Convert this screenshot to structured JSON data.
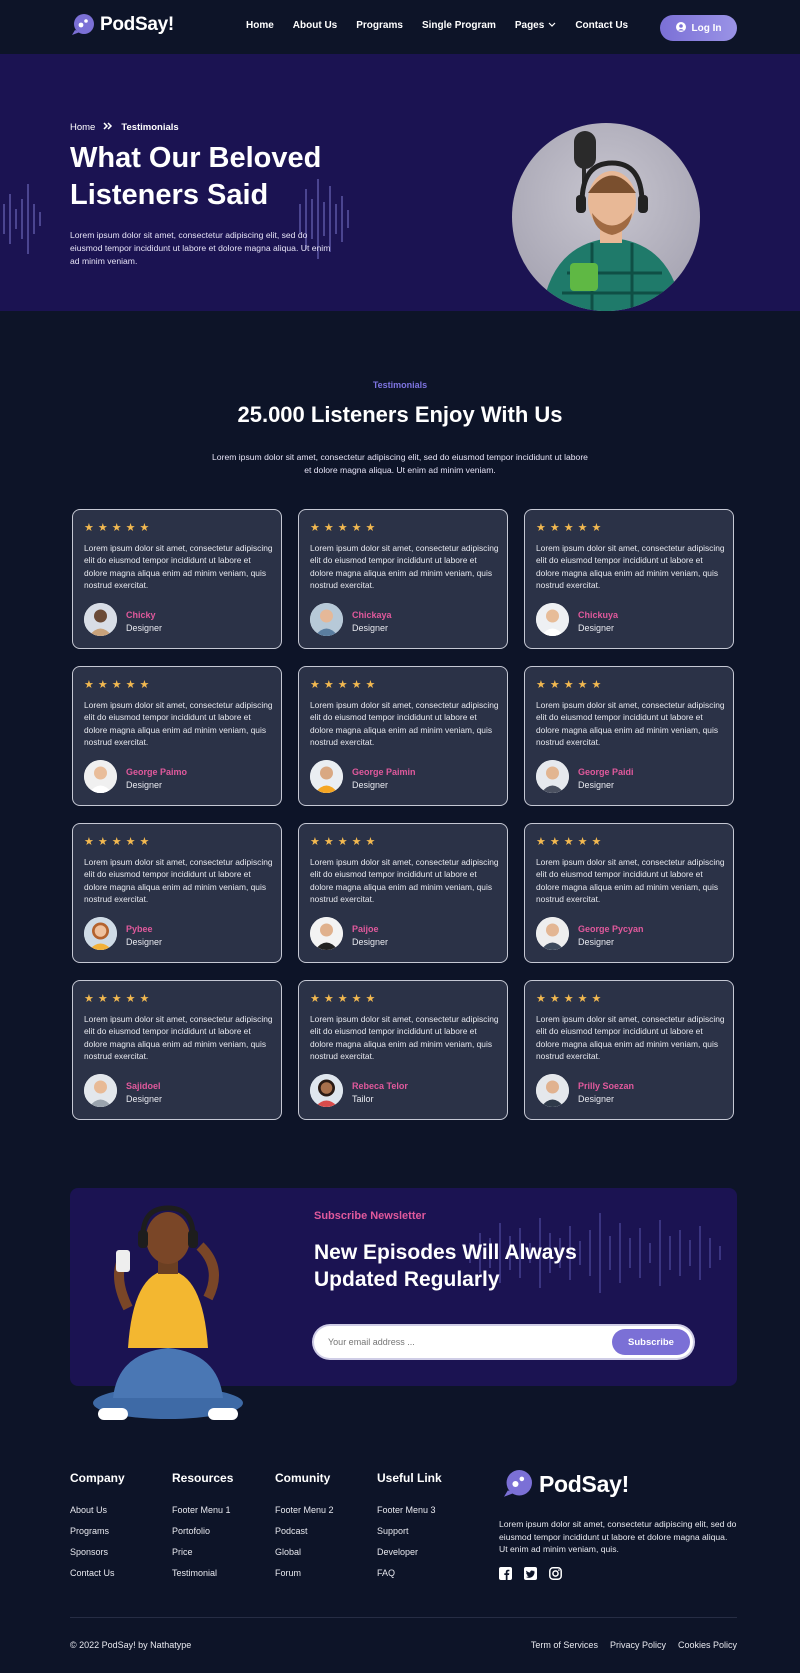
{
  "brand": {
    "name": "PodSay!",
    "accent": "#7b70d6",
    "pink": "#e0599c",
    "star": "#f3b950"
  },
  "nav": {
    "items": [
      {
        "label": "Home"
      },
      {
        "label": "About Us"
      },
      {
        "label": "Programs"
      },
      {
        "label": "Single Program"
      },
      {
        "label": "Pages"
      },
      {
        "label": "Contact Us"
      }
    ],
    "login_label": "Log In"
  },
  "hero": {
    "breadcrumb_home": "Home",
    "breadcrumb_current": "Testimonials",
    "title": "What Our Beloved Listeners Said",
    "description": "Lorem ipsum dolor sit amet, consectetur adipiscing elit, sed do eiusmod tempor incididunt ut labore et dolore magna aliqua. Ut enim ad minim veniam."
  },
  "testimonials": {
    "tag": "Testimonials",
    "title": "25.000 Listeners Enjoy With Us",
    "description": "Lorem ipsum dolor sit amet, consectetur adipiscing elit, sed do eiusmod tempor incididunt ut labore et dolore magna aliqua. Ut enim ad minim veniam.",
    "stars": "★★★★★",
    "rating": 5,
    "cards": [
      {
        "text": "Lorem ipsum dolor sit amet, consectetur adipiscing elit do eiusmod tempor incididunt ut labore et dolore magna aliqua enim ad minim veniam, quis nostrud exercitat.",
        "name": "Chicky",
        "role": "Designer"
      },
      {
        "text": "Lorem ipsum dolor sit amet, consectetur adipiscing elit do eiusmod tempor incididunt ut labore et dolore magna aliqua enim ad minim veniam, quis nostrud exercitat.",
        "name": "Chickaya",
        "role": "Designer"
      },
      {
        "text": "Lorem ipsum dolor sit amet, consectetur adipiscing elit do eiusmod tempor incididunt ut labore et dolore magna aliqua enim ad minim veniam, quis nostrud exercitat.",
        "name": "Chickuya",
        "role": "Designer"
      },
      {
        "text": "Lorem ipsum dolor sit amet, consectetur adipiscing elit do eiusmod tempor incididunt ut labore et dolore magna aliqua enim ad minim veniam, quis nostrud exercitat.",
        "name": "George Paimo",
        "role": "Designer"
      },
      {
        "text": "Lorem ipsum dolor sit amet, consectetur adipiscing elit do eiusmod tempor incididunt ut labore et dolore magna aliqua enim ad minim veniam, quis nostrud exercitat.",
        "name": "George Paimin",
        "role": "Designer"
      },
      {
        "text": "Lorem ipsum dolor sit amet, consectetur adipiscing elit do eiusmod tempor incididunt ut labore et dolore magna aliqua enim ad minim veniam, quis nostrud exercitat.",
        "name": "George Paidi",
        "role": "Designer"
      },
      {
        "text": "Lorem ipsum dolor sit amet, consectetur adipiscing elit do eiusmod tempor incididunt ut labore et dolore magna aliqua enim ad minim veniam, quis nostrud exercitat.",
        "name": "Pybee",
        "role": "Designer"
      },
      {
        "text": "Lorem ipsum dolor sit amet, consectetur adipiscing elit do eiusmod tempor incididunt ut labore et dolore magna aliqua enim ad minim veniam, quis nostrud exercitat.",
        "name": "Paijoe",
        "role": "Designer"
      },
      {
        "text": "Lorem ipsum dolor sit amet, consectetur adipiscing elit do eiusmod tempor incididunt ut labore et dolore magna aliqua enim ad minim veniam, quis nostrud exercitat.",
        "name": "George Pycyan",
        "role": "Designer"
      },
      {
        "text": "Lorem ipsum dolor sit amet, consectetur adipiscing elit do eiusmod tempor incididunt ut labore et dolore magna aliqua enim ad minim veniam, quis nostrud exercitat.",
        "name": "Sajidoel",
        "role": "Designer"
      },
      {
        "text": "Lorem ipsum dolor sit amet, consectetur adipiscing elit do eiusmod tempor incididunt ut labore et dolore magna aliqua enim ad minim veniam, quis nostrud exercitat.",
        "name": "Rebeca Telor",
        "role": "Tailor"
      },
      {
        "text": "Lorem ipsum dolor sit amet, consectetur adipiscing elit do eiusmod tempor incididunt ut labore et dolore magna aliqua enim ad minim veniam, quis nostrud exercitat.",
        "name": "Prilly Soezan",
        "role": "Designer"
      }
    ]
  },
  "newsletter": {
    "tag": "Subscribe Newsletter",
    "title": "New Episodes Will Always Updated Regularly",
    "placeholder": "Your email address ...",
    "button_label": "Subscribe"
  },
  "footer": {
    "columns": [
      {
        "heading": "Company",
        "links": [
          "About Us",
          "Programs",
          "Sponsors",
          "Contact Us"
        ]
      },
      {
        "heading": "Resources",
        "links": [
          "Footer Menu 1",
          "Portofolio",
          "Price",
          "Testimonial"
        ]
      },
      {
        "heading": "Comunity",
        "links": [
          "Footer Menu 2",
          "Podcast",
          "Global",
          "Forum"
        ]
      },
      {
        "heading": "Useful Link",
        "links": [
          "Footer Menu 3",
          "Support",
          "Developer",
          "FAQ"
        ]
      }
    ],
    "description": "Lorem ipsum dolor sit amet, consectetur adipiscing elit, sed do eiusmod tempor incididunt ut labore et dolore magna aliqua. Ut enim ad minim veniam, quis.",
    "socials": [
      "facebook-icon",
      "twitter-icon",
      "instagram-icon"
    ],
    "copyright": "© 2022 PodSay! by Nathatype",
    "legal_links": [
      "Term of Services",
      "Privacy Policy",
      "Cookies Policy"
    ]
  }
}
